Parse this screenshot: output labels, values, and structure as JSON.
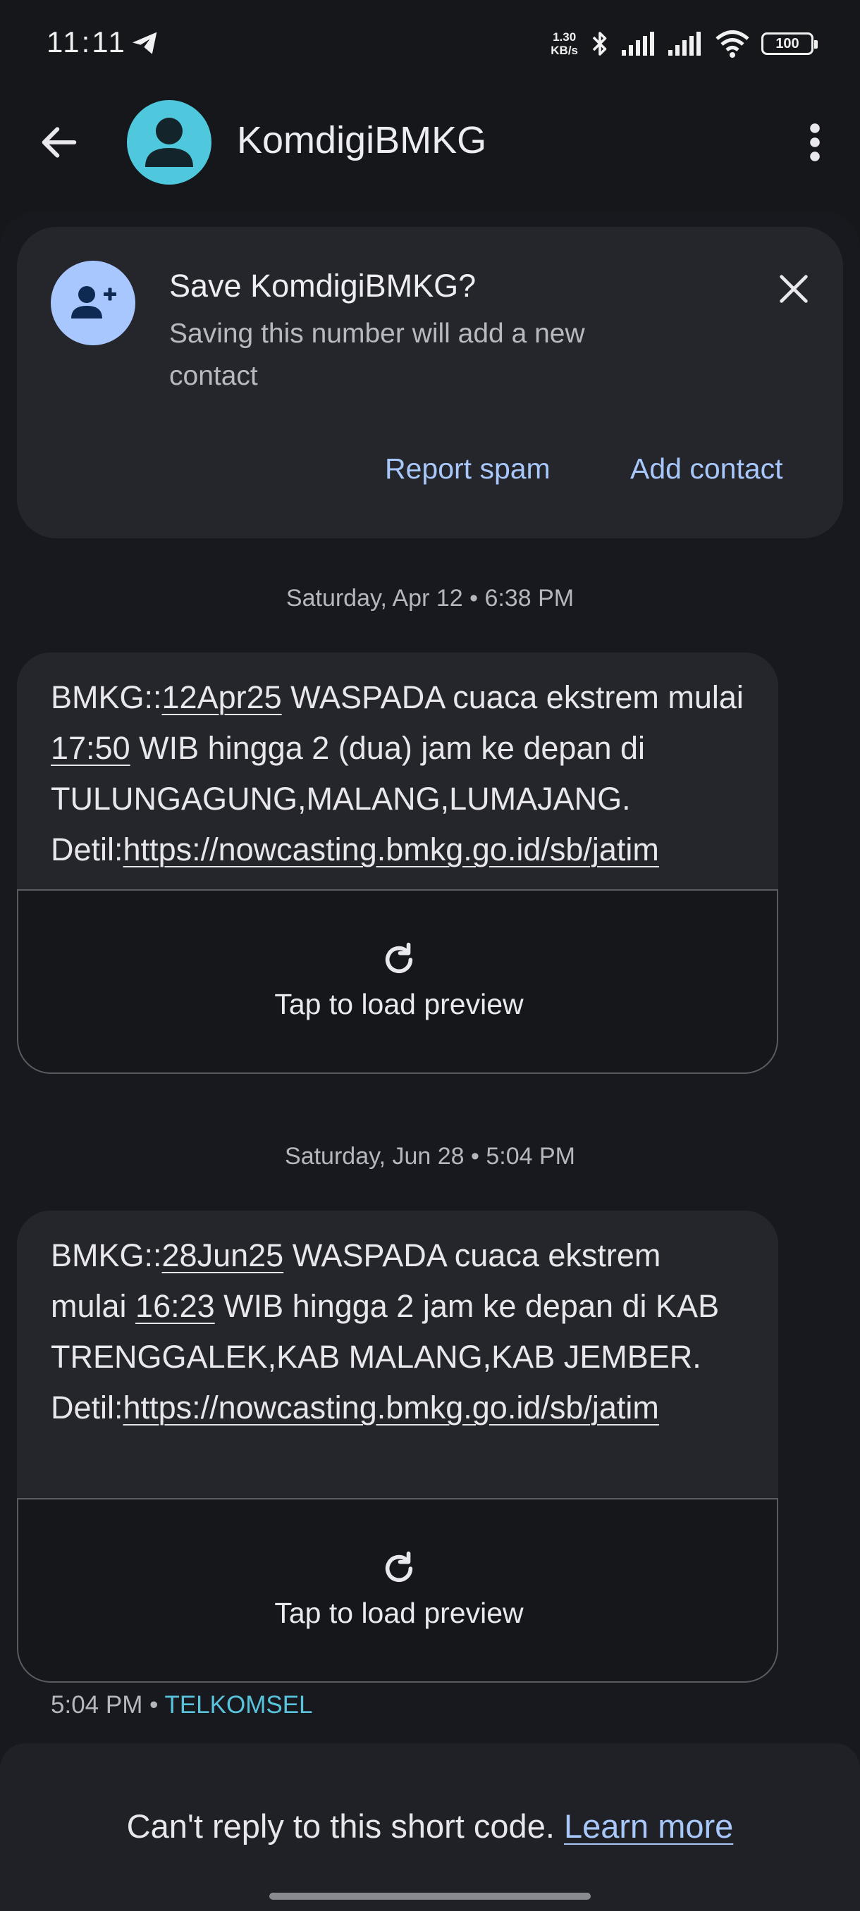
{
  "status_bar": {
    "time": "11:11",
    "net_speed_value": "1.30",
    "net_speed_unit": "KB/s",
    "battery": "100",
    "icons": [
      "telegram-icon",
      "bluetooth-icon",
      "signal-icon",
      "signal-icon",
      "wifi-icon",
      "battery-icon"
    ]
  },
  "app_bar": {
    "contact_name": "KomdigiBMKG",
    "icons": [
      "back-arrow-icon",
      "person-icon",
      "more-vert-icon"
    ]
  },
  "save_card": {
    "title": "Save KomdigiBMKG?",
    "subtitle": "Saving this number will add a new contact",
    "report_spam": "Report spam",
    "add_contact": "Add contact",
    "icons": [
      "person-add-icon",
      "close-icon"
    ]
  },
  "messages": [
    {
      "date": "Saturday, Apr 12 • 6:38 PM",
      "p1": "BMKG::",
      "date_link": "12Apr25",
      "p2": " WASPADA cuaca ekstrem mulai ",
      "time_link": "17:50",
      "p3": " WIB hingga 2 (dua) jam ke depan di  TULUNGAGUNG,MALANG,LUMAJANG. Detil:",
      "url": "https://nowcasting.bmkg.go.id/sb/jatim",
      "preview_label": "Tap to load preview"
    },
    {
      "date": "Saturday, Jun 28 • 5:04 PM",
      "p1": "BMKG::",
      "date_link": "28Jun25",
      "p2": " WASPADA cuaca ekstrem mulai ",
      "time_link": "16:23",
      "p3": " WIB hingga 2 jam ke depan di KAB TRENGGALEK,KAB MALANG,KAB JEMBER. Detil:",
      "url": "https://nowcasting.bmkg.go.id/sb/jatim",
      "preview_label": "Tap to load preview"
    }
  ],
  "last_meta": {
    "time": "5:04 PM",
    "separator": " • ",
    "carrier": "TELKOMSEL"
  },
  "footer": {
    "text": "Can't reply to this short code. ",
    "link": "Learn more"
  },
  "colors": {
    "background": "#15171b",
    "card": "#25262b",
    "accent_link": "#a8c7fa",
    "avatar": "#4fc7dc",
    "carrier": "#58c4dc"
  }
}
